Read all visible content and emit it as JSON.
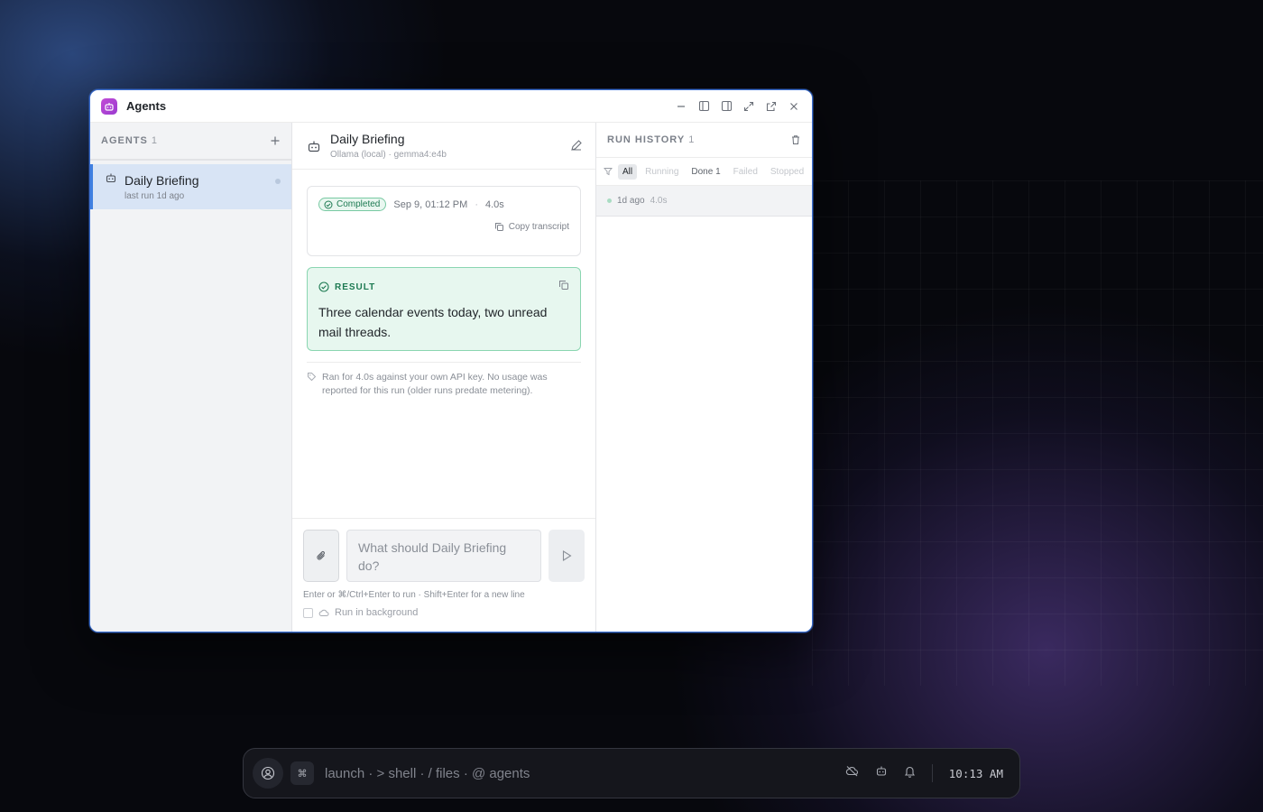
{
  "window": {
    "title": "Agents",
    "accent_color": "#3f7fe0",
    "app_icon": "robot-icon"
  },
  "sidebar": {
    "section_label": "AGENTS",
    "count": "1",
    "items": [
      {
        "name": "Daily Briefing",
        "subtitle": "last run 1d ago",
        "selected": true
      }
    ]
  },
  "main": {
    "agent_name": "Daily Briefing",
    "model": "Ollama (local) · gemma4:e4b",
    "run": {
      "status": "Completed",
      "status_color": "#1d7a52",
      "timestamp": "Sep 9, 01:12 PM",
      "duration": "4.0s",
      "copy_label": "Copy transcript"
    },
    "result": {
      "label": "RESULT",
      "text": "Three calendar events today, two unread mail threads."
    },
    "usage_note": "Ran for 4.0s against your own API key. No usage was reported for this run (older runs predate metering).",
    "composer": {
      "placeholder": "What should Daily Briefing do?",
      "hint": "Enter or ⌘/Ctrl+Enter to run · Shift+Enter for a new line",
      "background_label": "Run in background",
      "background_checked": false
    }
  },
  "history": {
    "title": "RUN HISTORY",
    "count": "1",
    "filters": [
      {
        "label": "All",
        "state": "active"
      },
      {
        "label": "Running",
        "state": "disabled"
      },
      {
        "label": "Done 1",
        "state": "normal"
      },
      {
        "label": "Failed",
        "state": "disabled"
      },
      {
        "label": "Stopped",
        "state": "disabled"
      }
    ],
    "runs": [
      {
        "when": "1d ago",
        "duration": "4.0s"
      }
    ]
  },
  "dock": {
    "shortcut_key": "⌘",
    "launcher_text": "launch · > shell · / files · @ agents",
    "clock": "10:13 AM"
  }
}
